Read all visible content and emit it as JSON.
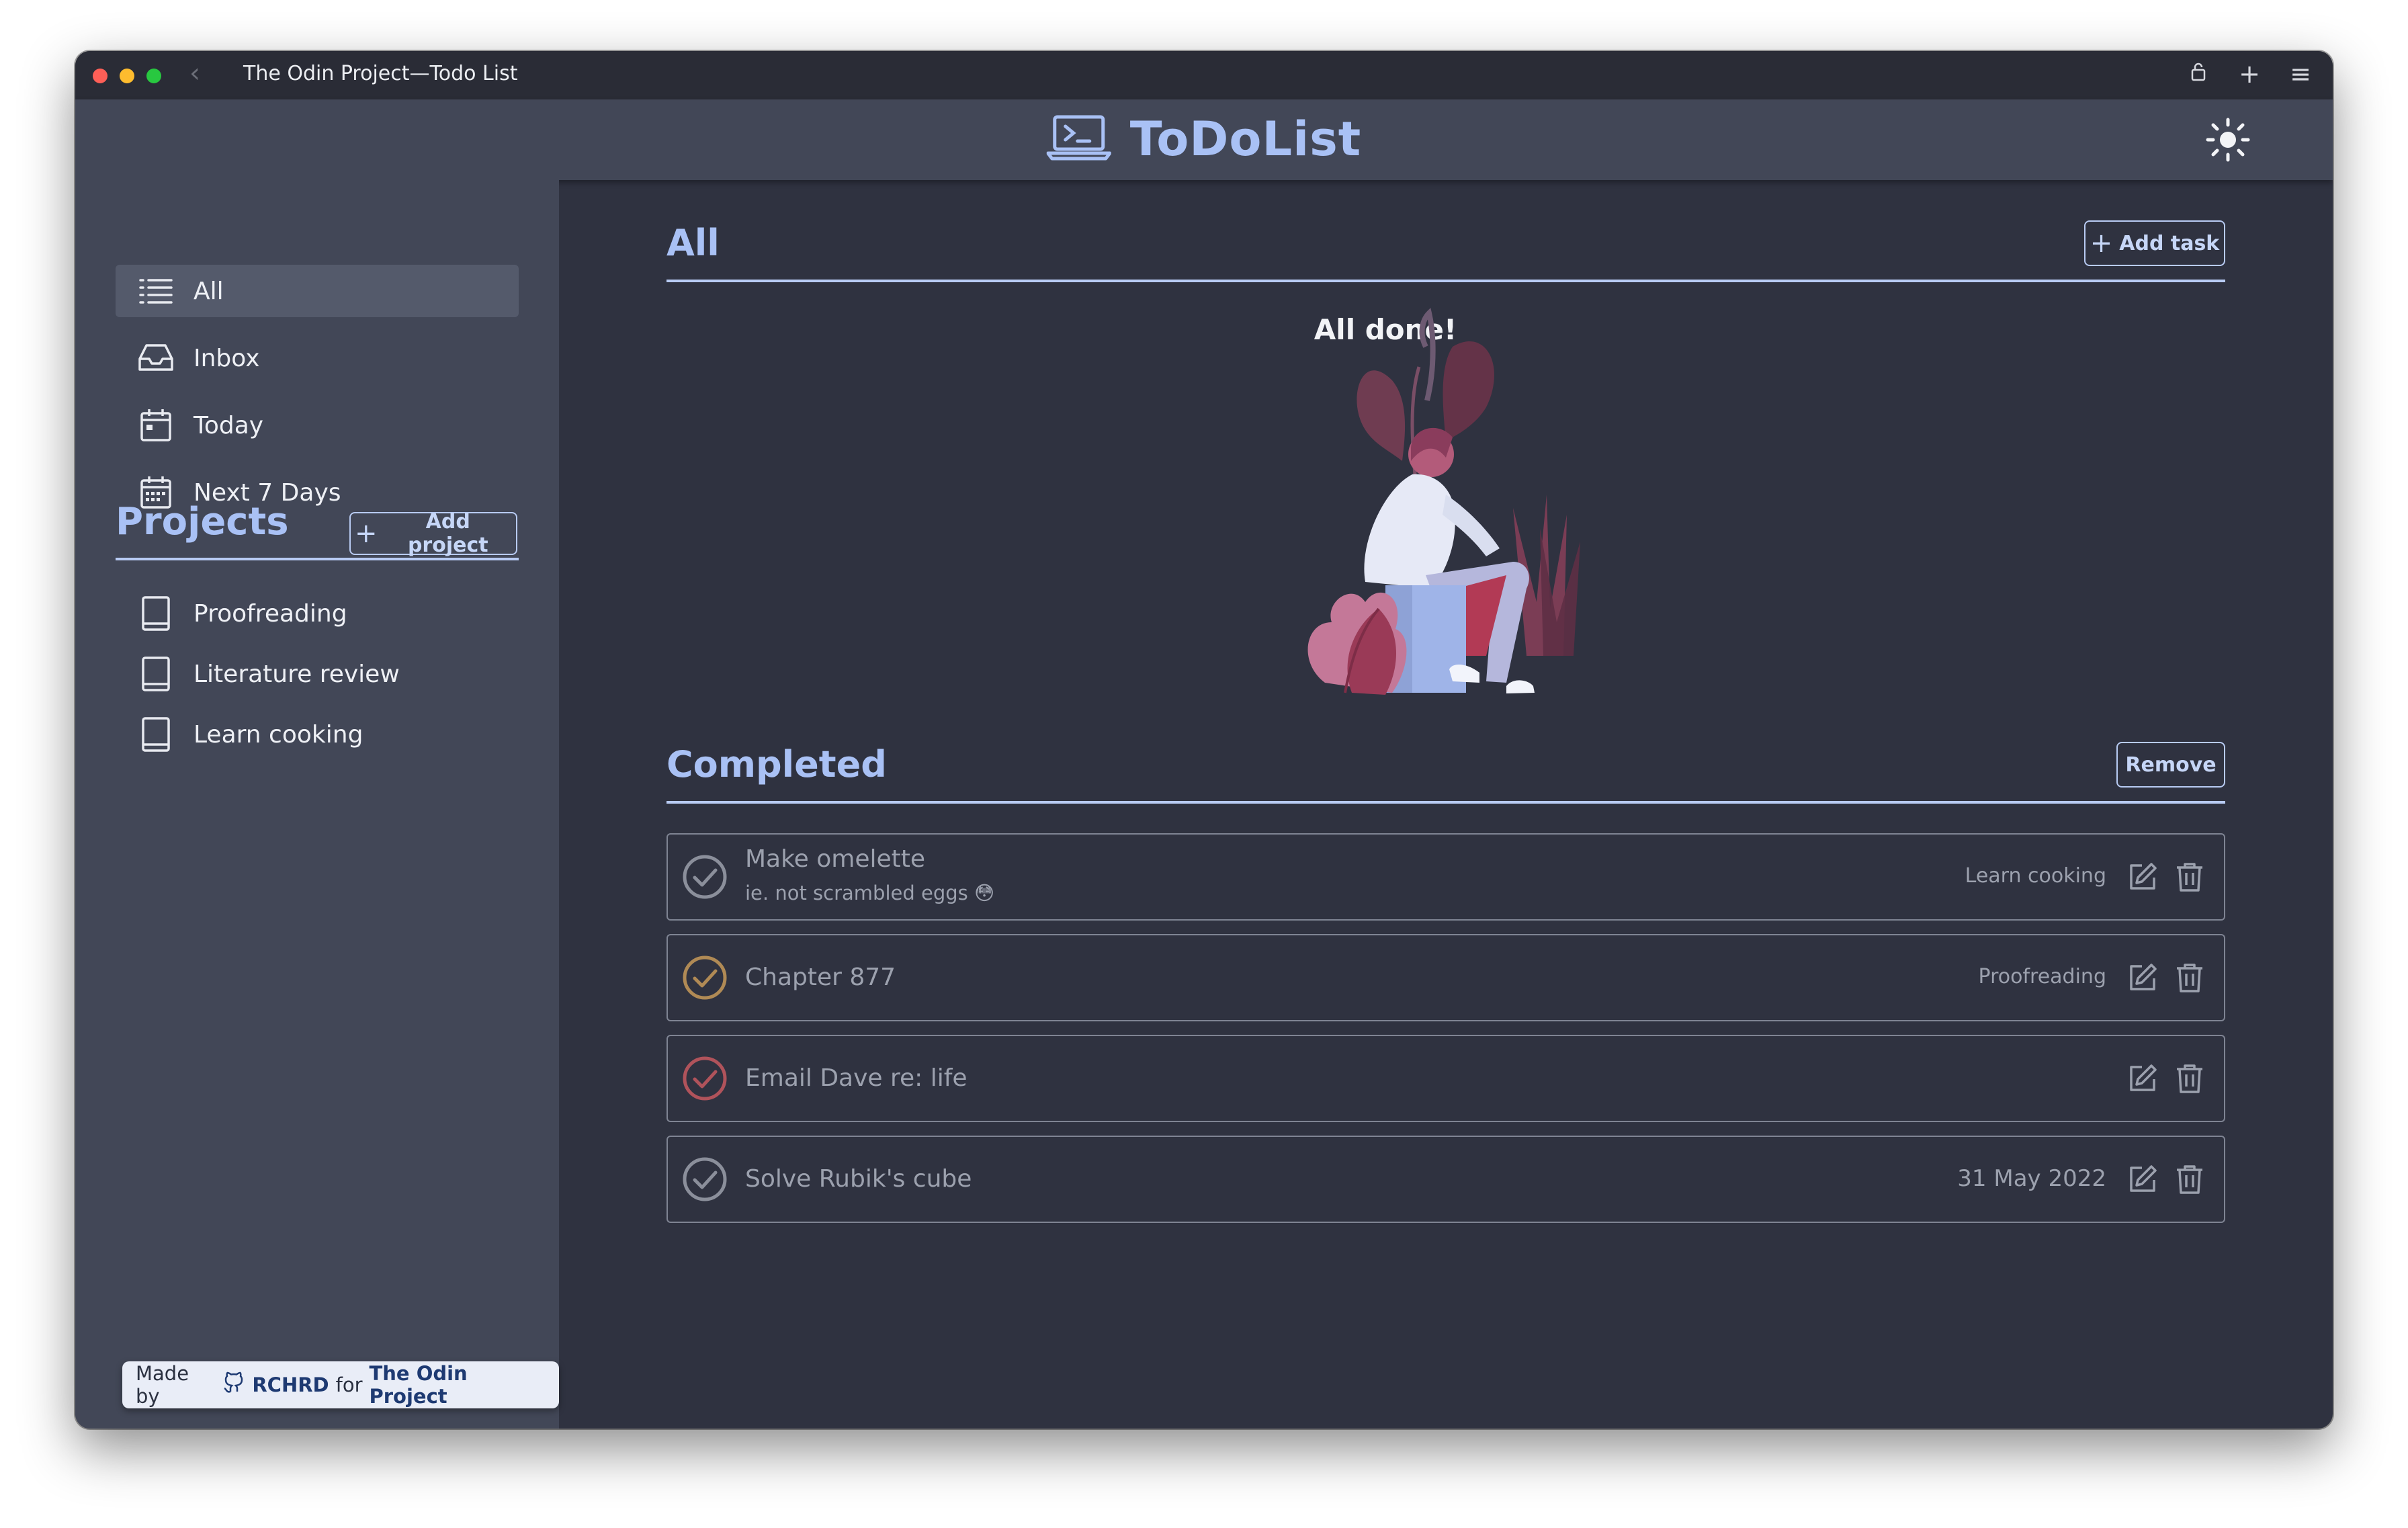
{
  "window": {
    "title": "The Odin Project—Todo List"
  },
  "header": {
    "app_name": "ToDoList",
    "theme_toggle_icon": "sun-icon"
  },
  "sidebar": {
    "nav": [
      {
        "label": "All",
        "icon": "list-icon",
        "active": true
      },
      {
        "label": "Inbox",
        "icon": "inbox-icon",
        "active": false
      },
      {
        "label": "Today",
        "icon": "calendar-icon",
        "active": false
      },
      {
        "label": "Next 7 Days",
        "icon": "calendar-week-icon",
        "active": false
      }
    ],
    "projects_title": "Projects",
    "add_project_label": "Add project",
    "projects": [
      {
        "label": "Proofreading",
        "icon": "book-icon"
      },
      {
        "label": "Literature review",
        "icon": "book-icon"
      },
      {
        "label": "Learn cooking",
        "icon": "book-icon"
      }
    ],
    "credit": {
      "prefix": "Made by",
      "author": "RCHRD",
      "middle": "for",
      "org": "The Odin Project"
    }
  },
  "main": {
    "title": "All",
    "add_task_label": "Add task",
    "empty_message": "All done!",
    "completed_title": "Completed",
    "remove_label": "Remove",
    "tasks": [
      {
        "name": "Make omelette",
        "description": "ie. not scrambled eggs 😳",
        "meta": "Learn cooking",
        "priority_color": "#8b8f9b"
      },
      {
        "name": "Chapter 877",
        "description": "",
        "meta": "Proofreading",
        "priority_color": "#b08a55"
      },
      {
        "name": "Email Dave re: life",
        "description": "",
        "meta": "",
        "priority_color": "#b0535b"
      },
      {
        "name": "Solve Rubik's cube",
        "description": "",
        "meta": "31 May 2022",
        "priority_color": "#8b8f9b"
      }
    ]
  },
  "colors": {
    "accent": "#a9c1f5",
    "background": "#2f3240",
    "panel": "#424757"
  }
}
